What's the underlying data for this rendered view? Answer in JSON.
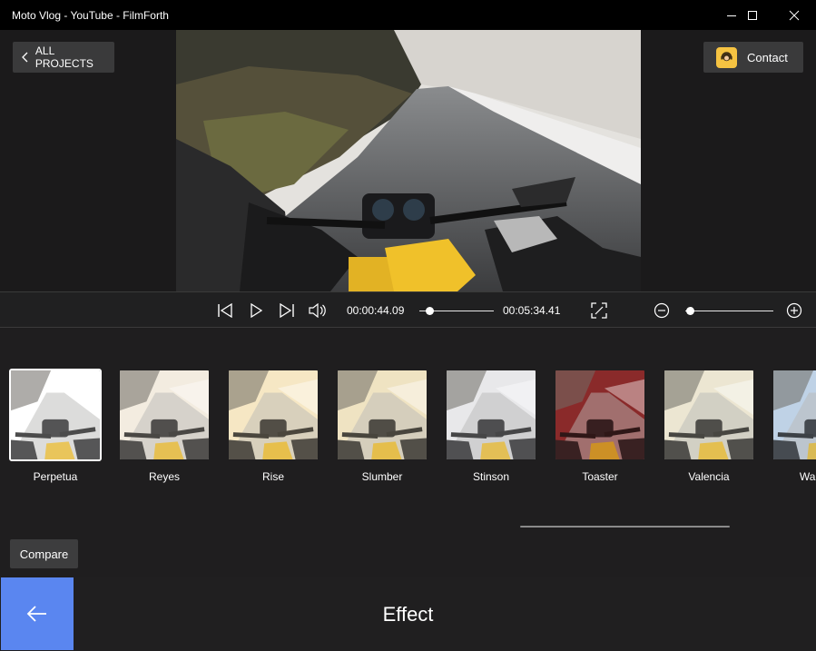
{
  "window": {
    "title": "Moto Vlog - YouTube - FilmForth",
    "controls": {
      "minimize": "minimize-icon",
      "maximize": "maximize-icon",
      "close": "close-icon"
    }
  },
  "header": {
    "all_projects_label": "ALL PROJECTS",
    "contact_label": "Contact"
  },
  "player": {
    "current_time": "00:00:44.09",
    "total_time": "00:05:34.41",
    "progress": 0.13,
    "zoom_level": 0.05,
    "icons": [
      "skip-start-icon",
      "play-icon",
      "skip-end-icon",
      "volume-icon",
      "fullscreen-icon",
      "zoom-out-icon",
      "zoom-in-icon"
    ]
  },
  "filters": {
    "selected": "Perpetua",
    "items": [
      {
        "name": "Perpetua",
        "tint": "#ffffff"
      },
      {
        "name": "Reyes",
        "tint": "#f3ece0"
      },
      {
        "name": "Rise",
        "tint": "#f6e7c4"
      },
      {
        "name": "Slumber",
        "tint": "#efe3c2"
      },
      {
        "name": "Stinson",
        "tint": "#e9e9ea"
      },
      {
        "name": "Toaster",
        "tint": "#8a2a2a"
      },
      {
        "name": "Valencia",
        "tint": "#ece6d2"
      },
      {
        "name": "Walden",
        "tint": "#bfd2e6"
      }
    ]
  },
  "compare_label": "Compare",
  "panel_title": "Effect",
  "colors": {
    "accent": "#5a86f0",
    "button_bg": "#3a3a3b",
    "contact_avatar": "#f6c342"
  }
}
